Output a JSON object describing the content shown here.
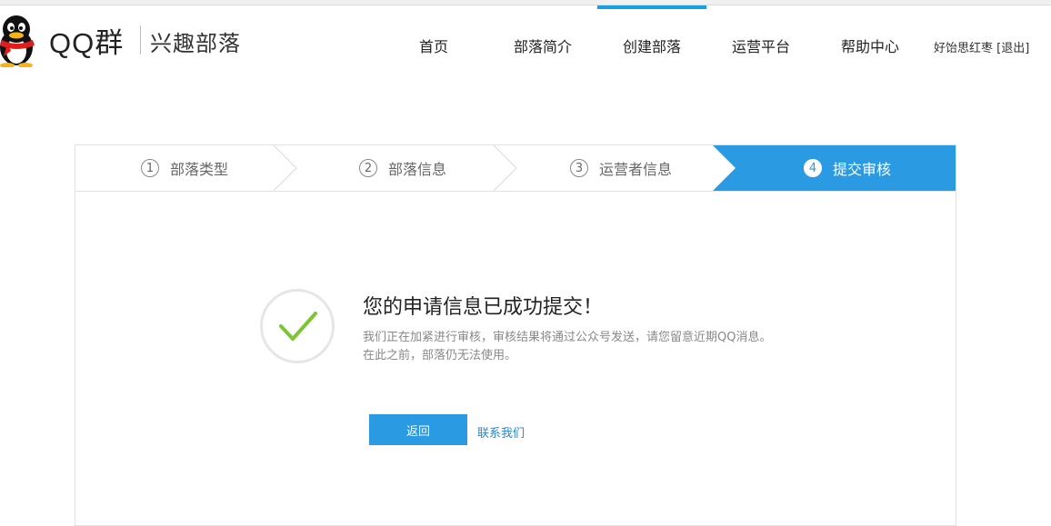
{
  "header": {
    "brand": "QQ群",
    "brand_sub": "兴趣部落",
    "nav": [
      {
        "label": "首页"
      },
      {
        "label": "部落简介"
      },
      {
        "label": "创建部落"
      },
      {
        "label": "运营平台"
      },
      {
        "label": "帮助中心"
      }
    ],
    "active_nav": "创建部落",
    "user_name": "好饴思红枣",
    "logout_label": "[退出]"
  },
  "steps": [
    {
      "num": "1",
      "label": "部落类型"
    },
    {
      "num": "2",
      "label": "部落信息"
    },
    {
      "num": "3",
      "label": "运营者信息"
    },
    {
      "num": "4",
      "label": "提交审核"
    }
  ],
  "active_step": 4,
  "result": {
    "title": "您的申请信息已成功提交！",
    "line1": "我们正在加紧进行审核，审核结果将通过公众号发送，请您留意近期QQ消息。",
    "line2": "在此之前，部落仍无法使用。",
    "back_button": "返回",
    "contact_link": "联系我们"
  },
  "colors": {
    "accent": "#2a9ae3",
    "nav_active": "#16a0e2",
    "check": "#7cc634"
  }
}
